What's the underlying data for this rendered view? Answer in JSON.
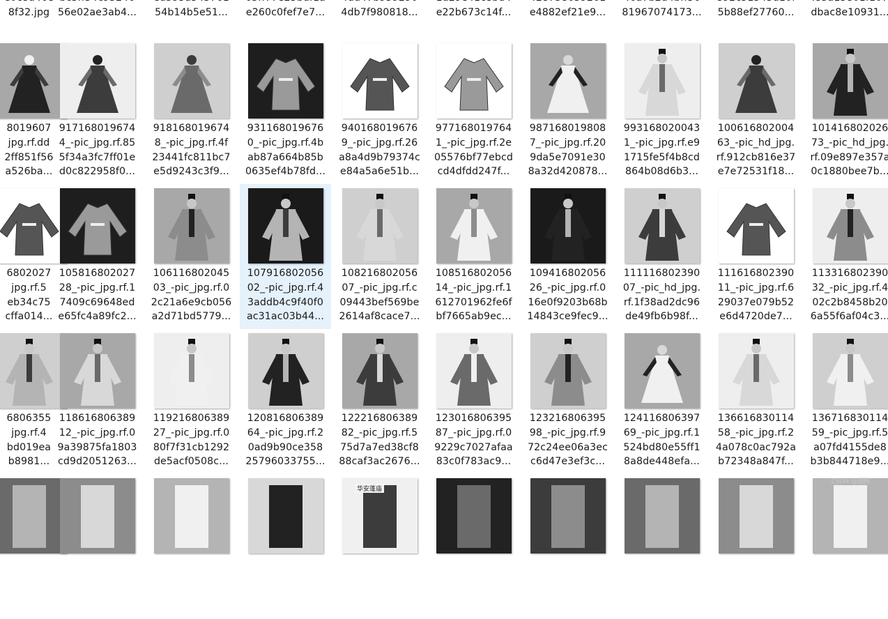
{
  "rows": [
    [
      {
        "l1": "",
        "l2": "",
        "l3": "4372023",
        "l4": "e0c8d46e",
        "l5": "8f32.jpg",
        "img": "partial"
      },
      {
        "l1": "",
        "l2": "",
        "l3": "4_-pic_jpg.rf.47",
        "l4": "bc3ff34c93246",
        "l5": "56e02ae3ab4...",
        "img": "partial"
      },
      {
        "l1": "",
        "l2": "",
        "l3": "0_-pic_jpg.rf.4f",
        "l4": "ed593a543761",
        "l5": "54b14b5e51...",
        "img": "partial"
      },
      {
        "l1": "",
        "l2": "",
        "l3": "4_-pic_jpg.rf.3d",
        "l4": "63ff77e23bdf1a",
        "l5": "e260c0fef7e7...",
        "img": "partial"
      },
      {
        "l1": "",
        "l2": "",
        "l3": "3_-pic_jpg.rf.a1",
        "l4": "4dd47b959290",
        "l5": "4db7f980818...",
        "img": "partial"
      },
      {
        "l1": "",
        "l2": "",
        "l3": "5_-pic_jpg.rf.73",
        "l4": "1d29e41c8bd4",
        "l5": "e22b673c14f...",
        "img": "partial"
      },
      {
        "l1": "",
        "l2": "",
        "l3": "1_-pic_jpg.rf.55",
        "l4": "428738639261",
        "l5": "e4882ef21e9...",
        "img": "partial"
      },
      {
        "l1": "",
        "l2": "",
        "l3": "1_-pic_jpg.rf.8a",
        "l4": "46a7b2d4bff36",
        "l5": "81967074173...",
        "img": "partial"
      },
      {
        "l1": "",
        "l2": "",
        "l3": "7_-pic_jpg.rf.5c",
        "l4": "892c51343d10f",
        "l5": "5b88ef27760...",
        "img": "partial"
      },
      {
        "l1": "",
        "l2": "",
        "l3": "3_-pic_hd_jpg.",
        "l4": ".83a13801f107",
        "l5": "dbac8e10931...",
        "img": "partial"
      }
    ],
    [
      {
        "l1": "8019607",
        "l2": "jpg.rf.dd",
        "l3": "2ff851f56",
        "l4": "a526ba...",
        "img": "dress"
      },
      {
        "l1": "917168019674",
        "l2": "4_-pic_jpg.rf.85",
        "l3": "5f34a3fc7ff01e",
        "l4": "d0c822958f0...",
        "img": "dress"
      },
      {
        "l1": "918168019674",
        "l2": "8_-pic_jpg.rf.4f",
        "l3": "23441fc811bc7",
        "l4": "e5d9243c3f9...",
        "img": "dress"
      },
      {
        "l1": "931168019676",
        "l2": "0_-pic_jpg.rf.4b",
        "l3": "ab87a664b85b",
        "l4": "0635ef4b78fd...",
        "img": "garment"
      },
      {
        "l1": "940168019676",
        "l2": "9_-pic_jpg.rf.26",
        "l3": "a8a4d9b79374c",
        "l4": "e84a5a6e51b...",
        "img": "garment"
      },
      {
        "l1": "977168019764",
        "l2": "1_-pic_jpg.rf.2e",
        "l3": "05576bf77ebcd",
        "l4": "cd4dfdd247f...",
        "img": "garment"
      },
      {
        "l1": "987168019808",
        "l2": "7_-pic_jpg.rf.20",
        "l3": "9da5e7091e30",
        "l4": "8a32d420878...",
        "img": "dress"
      },
      {
        "l1": "993168020043",
        "l2": "1_-pic_jpg.rf.e9",
        "l3": "1715fe5f4b8cd",
        "l4": "864b08d6b3...",
        "img": "robe"
      },
      {
        "l1": "100616802004",
        "l2": "63_-pic_hd_jpg.",
        "l3": "rf.912cb816e37",
        "l4": "e7e72531f18...",
        "img": "dress"
      },
      {
        "l1": "101416802026",
        "l2": "73_-pic_hd_jpg.",
        "l3": "rf.09e897e357a",
        "l4": "0c1880bee7b...",
        "img": "robe"
      }
    ],
    [
      {
        "l1": "6802027",
        "l2": "jpg.rf.5",
        "l3": "eb34c75",
        "l4": "cffa014...",
        "img": "garment"
      },
      {
        "l1": "105816802027",
        "l2": "28_-pic_jpg.rf.1",
        "l3": "7409c69648ed",
        "l4": "e65fc4a89fc2...",
        "img": "garment"
      },
      {
        "l1": "106116802045",
        "l2": "03_-pic_jpg.rf.0",
        "l3": "2c21a6e9cb056",
        "l4": "a2d71bd5779...",
        "img": "robe"
      },
      {
        "l1": "107916802056",
        "l2": "02_-pic_jpg.rf.4",
        "l3": "3addb4c9f40f0",
        "l4": "ac31ac03b44...",
        "img": "robe",
        "selected": true
      },
      {
        "l1": "108216802056",
        "l2": "07_-pic_jpg.rf.c",
        "l3": "09443bef569be",
        "l4": "2614af8cace7...",
        "img": "robe"
      },
      {
        "l1": "108516802056",
        "l2": "14_-pic_jpg.rf.1",
        "l3": "612701962fe6f",
        "l4": "bf7665ab9ec...",
        "img": "robe"
      },
      {
        "l1": "109416802056",
        "l2": "26_-pic_jpg.rf.0",
        "l3": "16e0f9203b68b",
        "l4": "14843ce9fec9...",
        "img": "robe"
      },
      {
        "l1": "111116802390",
        "l2": "07_-pic_hd_jpg.",
        "l3": "rf.1f38ad2dc96",
        "l4": "de49fb6b98f...",
        "img": "robe"
      },
      {
        "l1": "111616802390",
        "l2": "11_-pic_jpg.rf.6",
        "l3": "29037e079b52",
        "l4": "e6d4720de7...",
        "img": "garment"
      },
      {
        "l1": "113316802390",
        "l2": "32_-pic_jpg.rf.4",
        "l3": "02c2b8458b20",
        "l4": "6a55f6af04c3...",
        "img": "robe"
      }
    ],
    [
      {
        "l1": "6806355",
        "l2": "jpg.rf.4",
        "l3": "bd019ea",
        "l4": "b8981...",
        "img": "robe"
      },
      {
        "l1": "118616806389",
        "l2": "12_-pic_jpg.rf.0",
        "l3": "9a39875fa1803",
        "l4": "cd9d2051263...",
        "img": "robe"
      },
      {
        "l1": "119216806389",
        "l2": "27_-pic_jpg.rf.0",
        "l3": "80f7f31cb1292",
        "l4": "de5acf0508c...",
        "img": "robe"
      },
      {
        "l1": "120816806389",
        "l2": "64_-pic_jpg.rf.2",
        "l3": "0ad9b90ce358",
        "l4": "25796033755...",
        "img": "robe"
      },
      {
        "l1": "122216806389",
        "l2": "82_-pic_jpg.rf.5",
        "l3": "75d7a7ed38cf8",
        "l4": "88caf3ac2676...",
        "img": "robe"
      },
      {
        "l1": "123016806395",
        "l2": "87_-pic_jpg.rf.0",
        "l3": "9229c7027afaa",
        "l4": "83c0f783ac9...",
        "img": "robe"
      },
      {
        "l1": "123216806395",
        "l2": "98_-pic_jpg.rf.9",
        "l3": "72c24ee06a3ec",
        "l4": "c6d47e3ef3c...",
        "img": "robe"
      },
      {
        "l1": "124116806397",
        "l2": "69_-pic_jpg.rf.1",
        "l3": "524bd80e55ff1",
        "l4": "8a8de448efa...",
        "img": "dress"
      },
      {
        "l1": "136616830114",
        "l2": "58_-pic_jpg.rf.2",
        "l3": "4a078c0ac792a",
        "l4": "b72348a847f...",
        "img": "robe"
      },
      {
        "l1": "136716830114",
        "l2": "59_-pic_jpg.rf.5",
        "l3": "a07fd4155de8",
        "l4": "b3b844718e9...",
        "img": "robe"
      }
    ],
    [
      {
        "img": "partial"
      },
      {
        "img": "partial"
      },
      {
        "img": "partial"
      },
      {
        "img": "partial"
      },
      {
        "img": "partial"
      },
      {
        "img": "partial"
      },
      {
        "img": "partial"
      },
      {
        "img": "partial"
      },
      {
        "img": "partial"
      },
      {
        "img": "partial"
      }
    ]
  ],
  "partial_bottom_label": "华安蓬庙",
  "watermark": "CSDN @胡腾",
  "colors": {
    "selected_bg": "#e5f1fb",
    "text": "#1a1a1a"
  }
}
